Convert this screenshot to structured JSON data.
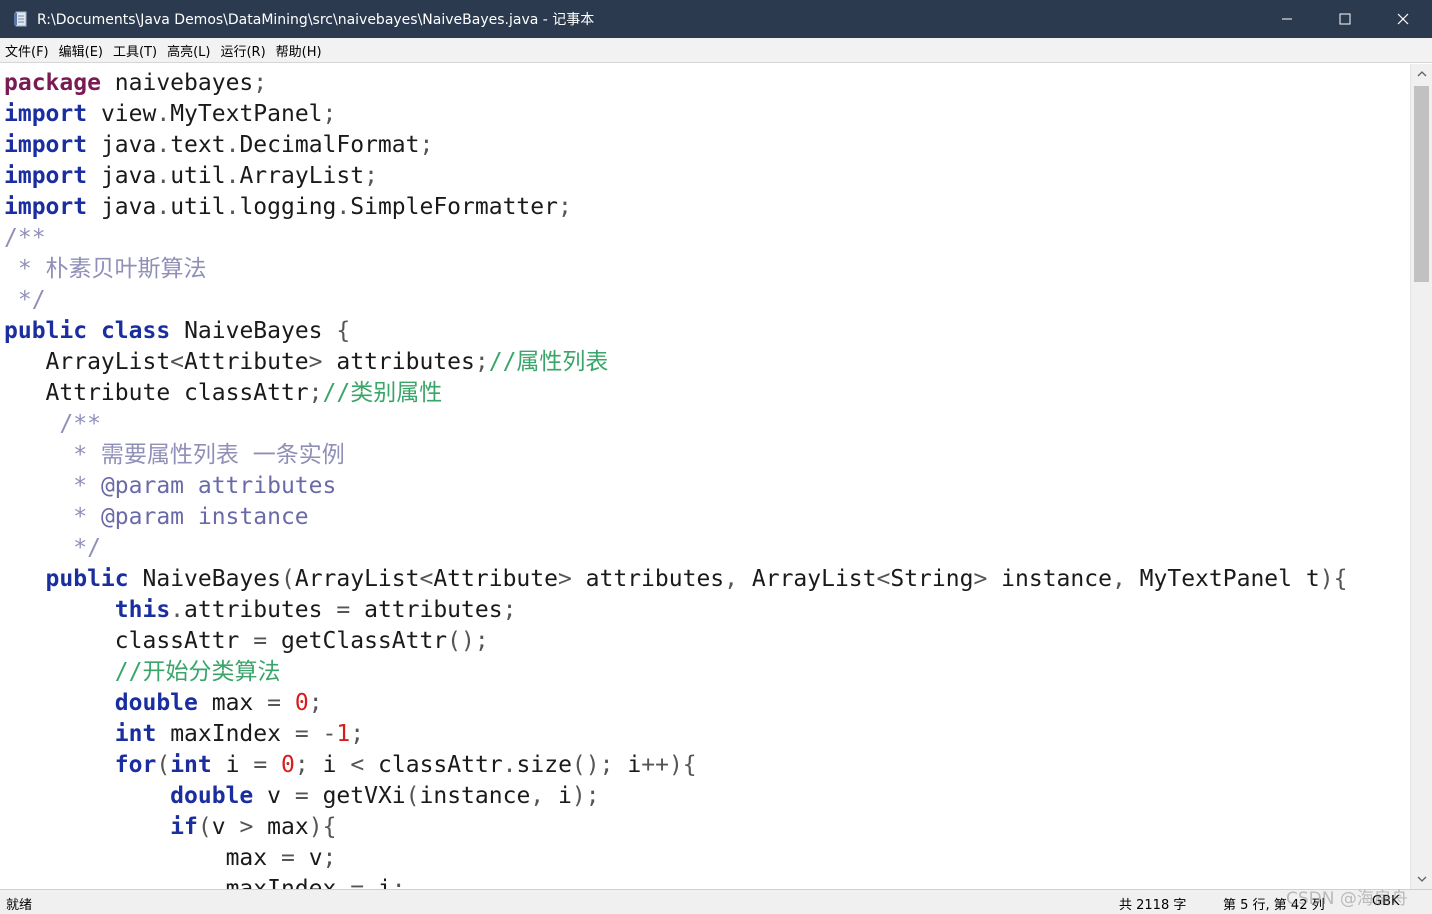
{
  "window": {
    "title": "R:\\Documents\\Java Demos\\DataMining\\src\\naivebayes\\NaiveBayes.java - 记事本",
    "controls": [
      "minimize-icon",
      "maximize-icon",
      "close-icon"
    ]
  },
  "menu": {
    "items": [
      "文件(F)",
      "编辑(E)",
      "工具(T)",
      "高亮(L)",
      "运行(R)",
      "帮助(H)"
    ]
  },
  "code": {
    "lines": [
      "package naivebayes;",
      "import view.MyTextPanel;",
      "import java.text.DecimalFormat;",
      "import java.util.ArrayList;",
      "import java.util.logging.SimpleFormatter;",
      "/**",
      " * 朴素贝叶斯算法",
      " */",
      "public class NaiveBayes {",
      "   ArrayList<Attribute> attributes;//属性列表",
      "   Attribute classAttr;//类别属性",
      "    /**",
      "     * 需要属性列表 一条实例",
      "     * @param attributes",
      "     * @param instance",
      "     */",
      "   public NaiveBayes(ArrayList<Attribute> attributes, ArrayList<String> instance, MyTextPanel t){",
      "        this.attributes = attributes;",
      "        classAttr = getClassAttr();",
      "        //开始分类算法",
      "        double max = 0;",
      "        int maxIndex = -1;",
      "        for(int i = 0; i < classAttr.size(); i++){",
      "            double v = getVXi(instance, i);",
      "            if(v > max){",
      "                max = v;",
      "                maxIndex = i;"
    ]
  },
  "status": {
    "ready": "就绪",
    "char_count": "共 2118 字",
    "position": "第 5 行, 第 42 列",
    "encoding": "GBK"
  },
  "watermark": "CSDN @海扁舟",
  "colors": {
    "titlebar": "#2b3a4f",
    "keyword": "#1a2ea0",
    "package_keyword": "#7a1a52",
    "number": "#d81b1b",
    "comment": "#8f8fb8",
    "inline_comment": "#3aa56a"
  }
}
